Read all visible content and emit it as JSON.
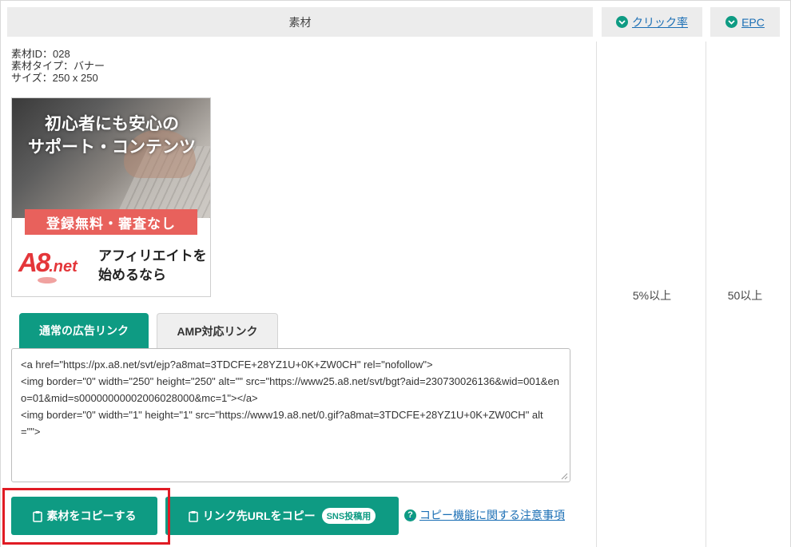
{
  "header": {
    "material_label": "素材",
    "click_rate_label": "クリック率",
    "epc_label": "EPC"
  },
  "material": {
    "id_line": "素材ID：028",
    "type_line": "素材タイプ：バナー",
    "size_line": "サイズ：250 x 250"
  },
  "banner": {
    "title_line1": "初心者にも安心の",
    "title_line2": "サポート・コンテンツ",
    "ribbon": "登録無料・審査なし",
    "logo_main": "A8",
    "logo_suffix": ".net",
    "sub_line1": "アフィリエイトを",
    "sub_line2": "始めるなら"
  },
  "tabs": [
    {
      "label": "通常の広告リンク",
      "active": true
    },
    {
      "label": "AMP対応リンク",
      "active": false
    }
  ],
  "code": "<a href=\"https://px.a8.net/svt/ejp?a8mat=3TDCFE+28YZ1U+0K+ZW0CH\" rel=\"nofollow\">\n<img border=\"0\" width=\"250\" height=\"250\" alt=\"\" src=\"https://www25.a8.net/svt/bgt?aid=230730026136&wid=001&eno=01&mid=s00000000002006028000&mc=1\"></a>\n<img border=\"0\" width=\"1\" height=\"1\" src=\"https://www19.a8.net/0.gif?a8mat=3TDCFE+28YZ1U+0K+ZW0CH\" alt=\"\">",
  "buttons": {
    "copy_label": "素材をコピーする",
    "url_copy_label": "リンク先URLをコピー",
    "sns_badge": "SNS投稿用",
    "notice_link": "コピー機能に関する注意事項"
  },
  "stats": {
    "click_rate": "5%以上",
    "epc": "50以上"
  },
  "colors": {
    "accent": "#0e9b83",
    "link": "#1b6fb5",
    "highlight": "#e01b24"
  }
}
